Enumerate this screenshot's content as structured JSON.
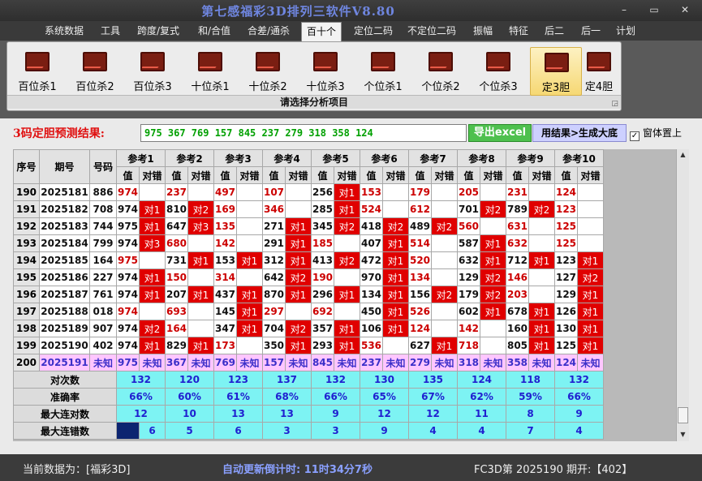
{
  "window": {
    "title": "第七感福彩3D排列三软件V8.80",
    "minimize": "–",
    "maximize": "▭",
    "close": "✕"
  },
  "menu": [
    "系统数据",
    "工具",
    "跨度/复式",
    "和/合值",
    "合差/通杀",
    "百十个",
    "定位二码",
    "不定位二码",
    "振幅",
    "特征",
    "后二",
    "后一",
    "计划"
  ],
  "menu_active": "百十个",
  "ribbon": {
    "buttons": [
      "百位杀1",
      "百位杀2",
      "百位杀3",
      "十位杀1",
      "十位杀2",
      "十位杀3",
      "个位杀1",
      "个位杀2",
      "个位杀3",
      "定3胆",
      "定4胆"
    ],
    "selected": "定3胆",
    "caption": "请选择分析项目",
    "launcher_icon": "dialog-launcher-icon"
  },
  "prediction": {
    "label": "3码定胆预测结果:",
    "value": "975 367 769 157 845 237 279 318 358 124",
    "excel_button": "导出excel",
    "generate_button": "用结果>生成大底",
    "topmost_label": "窗体置上",
    "topmost_checked": "✓"
  },
  "table": {
    "headers": {
      "index": "序号",
      "period": "期号",
      "number": "号码",
      "value": "值",
      "result": "对错"
    },
    "groups": [
      "参考1",
      "参考2",
      "参考3",
      "参考4",
      "参考5",
      "参考6",
      "参考7",
      "参考8",
      "参考9",
      "参考10"
    ],
    "rows": [
      {
        "index": "190",
        "period": "2025181",
        "number": "886",
        "cells": [
          [
            "974",
            ""
          ],
          [
            "237",
            ""
          ],
          [
            "497",
            ""
          ],
          [
            "107",
            ""
          ],
          [
            "256",
            "对1"
          ],
          [
            "153",
            ""
          ],
          [
            "179",
            ""
          ],
          [
            "205",
            ""
          ],
          [
            "231",
            ""
          ],
          [
            "124",
            ""
          ]
        ]
      },
      {
        "index": "191",
        "period": "2025182",
        "number": "708",
        "cells": [
          [
            "974",
            "对1"
          ],
          [
            "810",
            "对2"
          ],
          [
            "169",
            ""
          ],
          [
            "346",
            ""
          ],
          [
            "285",
            "对1"
          ],
          [
            "524",
            ""
          ],
          [
            "612",
            ""
          ],
          [
            "701",
            "对2"
          ],
          [
            "789",
            "对2"
          ],
          [
            "123",
            ""
          ]
        ]
      },
      {
        "index": "192",
        "period": "2025183",
        "number": "744",
        "cells": [
          [
            "975",
            "对1"
          ],
          [
            "647",
            "对3"
          ],
          [
            "135",
            ""
          ],
          [
            "271",
            "对1"
          ],
          [
            "345",
            "对2"
          ],
          [
            "418",
            "对2"
          ],
          [
            "489",
            "对2"
          ],
          [
            "560",
            ""
          ],
          [
            "631",
            ""
          ],
          [
            "125",
            ""
          ]
        ]
      },
      {
        "index": "193",
        "period": "2025184",
        "number": "799",
        "cells": [
          [
            "974",
            "对3"
          ],
          [
            "680",
            ""
          ],
          [
            "142",
            ""
          ],
          [
            "291",
            "对1"
          ],
          [
            "185",
            ""
          ],
          [
            "407",
            "对1"
          ],
          [
            "514",
            ""
          ],
          [
            "587",
            "对1"
          ],
          [
            "632",
            ""
          ],
          [
            "125",
            ""
          ]
        ]
      },
      {
        "index": "194",
        "period": "2025185",
        "number": "164",
        "cells": [
          [
            "975",
            ""
          ],
          [
            "731",
            "对1"
          ],
          [
            "153",
            "对1"
          ],
          [
            "312",
            "对1"
          ],
          [
            "413",
            "对2"
          ],
          [
            "472",
            "对1"
          ],
          [
            "520",
            ""
          ],
          [
            "632",
            "对1"
          ],
          [
            "712",
            "对1"
          ],
          [
            "123",
            "对1"
          ]
        ]
      },
      {
        "index": "195",
        "period": "2025186",
        "number": "227",
        "cells": [
          [
            "974",
            "对1"
          ],
          [
            "150",
            ""
          ],
          [
            "314",
            ""
          ],
          [
            "642",
            "对2"
          ],
          [
            "190",
            ""
          ],
          [
            "970",
            "对1"
          ],
          [
            "134",
            ""
          ],
          [
            "129",
            "对2"
          ],
          [
            "146",
            ""
          ],
          [
            "127",
            "对2"
          ]
        ]
      },
      {
        "index": "196",
        "period": "2025187",
        "number": "761",
        "cells": [
          [
            "974",
            "对1"
          ],
          [
            "207",
            "对1"
          ],
          [
            "437",
            "对1"
          ],
          [
            "870",
            "对1"
          ],
          [
            "296",
            "对1"
          ],
          [
            "134",
            "对1"
          ],
          [
            "156",
            "对2"
          ],
          [
            "179",
            "对2"
          ],
          [
            "203",
            ""
          ],
          [
            "129",
            "对1"
          ]
        ]
      },
      {
        "index": "197",
        "period": "2025188",
        "number": "018",
        "cells": [
          [
            "974",
            ""
          ],
          [
            "693",
            ""
          ],
          [
            "145",
            "对1"
          ],
          [
            "297",
            ""
          ],
          [
            "692",
            ""
          ],
          [
            "450",
            "对1"
          ],
          [
            "526",
            ""
          ],
          [
            "602",
            "对1"
          ],
          [
            "678",
            "对1"
          ],
          [
            "126",
            "对1"
          ]
        ]
      },
      {
        "index": "198",
        "period": "2025189",
        "number": "907",
        "cells": [
          [
            "974",
            "对2"
          ],
          [
            "164",
            ""
          ],
          [
            "347",
            "对1"
          ],
          [
            "704",
            "对2"
          ],
          [
            "357",
            "对1"
          ],
          [
            "106",
            "对1"
          ],
          [
            "124",
            ""
          ],
          [
            "142",
            ""
          ],
          [
            "160",
            "对1"
          ],
          [
            "130",
            "对1"
          ]
        ]
      },
      {
        "index": "199",
        "period": "2025190",
        "number": "402",
        "cells": [
          [
            "974",
            "对1"
          ],
          [
            "829",
            "对1"
          ],
          [
            "173",
            ""
          ],
          [
            "350",
            "对1"
          ],
          [
            "293",
            "对1"
          ],
          [
            "536",
            ""
          ],
          [
            "627",
            "对1"
          ],
          [
            "718",
            ""
          ],
          [
            "805",
            "对1"
          ],
          [
            "125",
            "对1"
          ]
        ]
      }
    ],
    "unknown_row": {
      "index": "200",
      "period": "2025191",
      "number": "未知",
      "cells": [
        [
          "975",
          "未知"
        ],
        [
          "367",
          "未知"
        ],
        [
          "769",
          "未知"
        ],
        [
          "157",
          "未知"
        ],
        [
          "845",
          "未知"
        ],
        [
          "237",
          "未知"
        ],
        [
          "279",
          "未知"
        ],
        [
          "318",
          "未知"
        ],
        [
          "358",
          "未知"
        ],
        [
          "124",
          "未知"
        ]
      ]
    },
    "stats": [
      {
        "label": "对次数",
        "values": [
          "132",
          "120",
          "123",
          "137",
          "132",
          "130",
          "135",
          "124",
          "118",
          "132"
        ]
      },
      {
        "label": "准确率",
        "values": [
          "66%",
          "60%",
          "61%",
          "68%",
          "66%",
          "65%",
          "67%",
          "62%",
          "59%",
          "66%"
        ]
      },
      {
        "label": "最大连对数",
        "values": [
          "12",
          "10",
          "13",
          "13",
          "9",
          "12",
          "12",
          "11",
          "8",
          "9"
        ]
      },
      {
        "label": "最大连错数",
        "values": [
          "6",
          "5",
          "6",
          "3",
          "3",
          "9",
          "4",
          "4",
          "7",
          "4"
        ]
      }
    ]
  },
  "status": {
    "current_data": "当前数据为：[福彩3D]",
    "countdown": "自动更新倒计时:  11时34分7秒",
    "issue": "FC3D第 2025190 期开:【402】"
  }
}
